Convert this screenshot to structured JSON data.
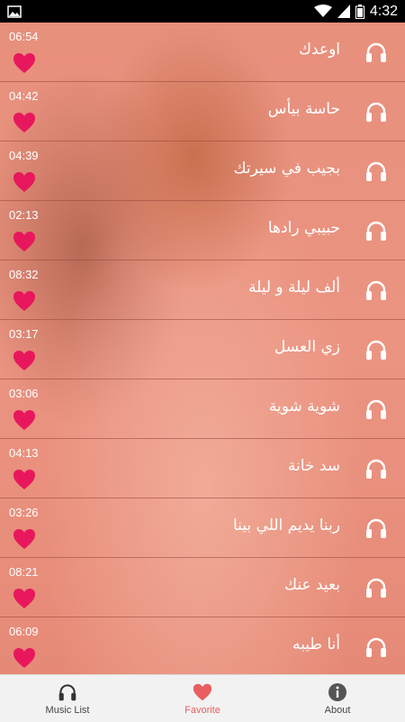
{
  "status_bar": {
    "time": "4:32"
  },
  "colors": {
    "heart": "#e8175d",
    "nav_active": "#e95f5f",
    "bg": "#e88b78"
  },
  "songs": [
    {
      "title": "اوعدك",
      "duration": "06:54"
    },
    {
      "title": "حاسة بيأس",
      "duration": "04:42"
    },
    {
      "title": "بجيب في سيرتك",
      "duration": "04:39"
    },
    {
      "title": "حبيبي رادها",
      "duration": "02:13"
    },
    {
      "title": "ألف ليلة و ليلة",
      "duration": "08:32"
    },
    {
      "title": "زي العسل",
      "duration": "03:17"
    },
    {
      "title": "شوية شوية",
      "duration": "03:06"
    },
    {
      "title": "سد خانة",
      "duration": "04:13"
    },
    {
      "title": "ربنا يديم اللي بينا",
      "duration": "03:26"
    },
    {
      "title": "بعيد عنك",
      "duration": "08:21"
    },
    {
      "title": "أنا طيبه",
      "duration": "06:09"
    }
  ],
  "bottom_nav": {
    "items": [
      {
        "label": "Music List",
        "icon": "headphones-icon"
      },
      {
        "label": "Favorite",
        "icon": "heart-icon"
      },
      {
        "label": "About",
        "icon": "info-icon"
      }
    ]
  }
}
